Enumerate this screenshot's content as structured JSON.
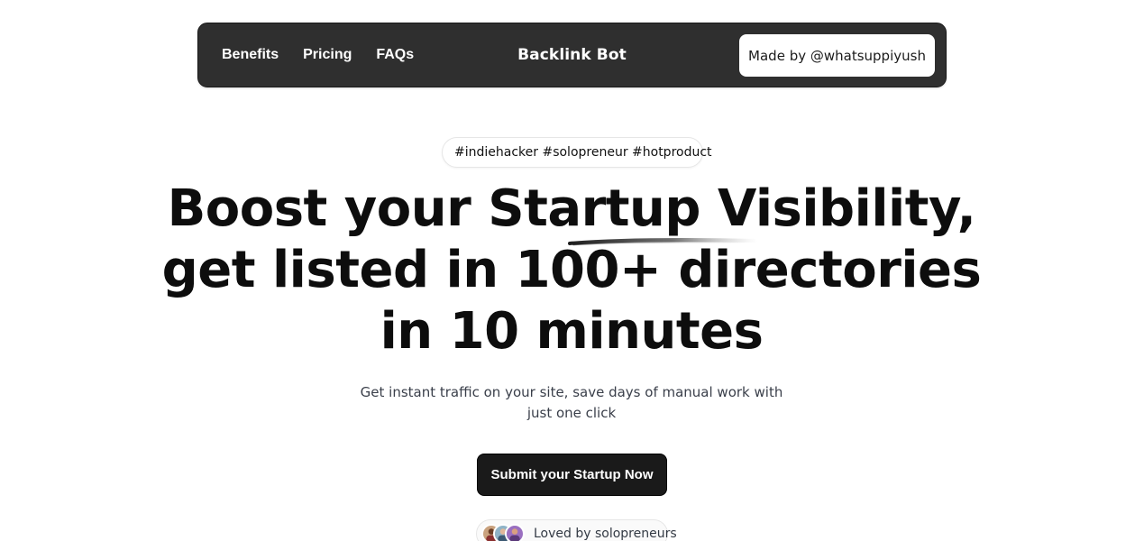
{
  "navbar": {
    "links": [
      "Benefits",
      "Pricing",
      "FAQs"
    ],
    "brand": "Backlink Bot",
    "made_by": "Made by @whatsuppiyush"
  },
  "hero": {
    "tags": "#indiehacker #solopreneur #hotproduct",
    "tag_icon": "lightning-bolt-icon",
    "headline_lines": [
      "Boost your Startup Visibility,",
      "get listed in 100+ directories",
      "in 10 minutes"
    ],
    "subtitle_lines": [
      "Get instant traffic on your site, save days of manual work with",
      "just one click"
    ],
    "cta_label": "Submit your Startup Now",
    "social_proof": "Loved by solopreneurs"
  },
  "colors": {
    "navbar_bg": "#2f2f2f",
    "cta_bg": "#1a1a1a",
    "text": "#0d0d0d",
    "subtitle": "#3a3f4a"
  }
}
